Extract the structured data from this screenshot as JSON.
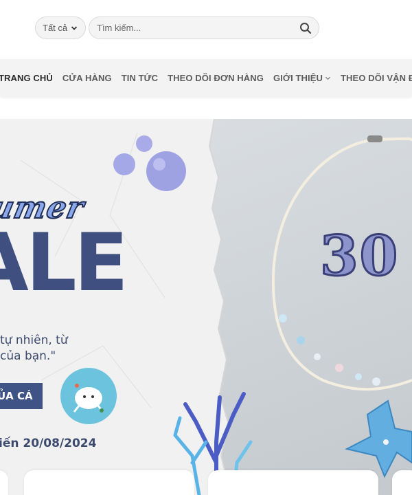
{
  "header": {
    "category_select": "Tất cả",
    "search_placeholder": "Tìm kiếm..."
  },
  "nav": {
    "items": [
      {
        "label": "TRANG CHỦ",
        "active": true
      },
      {
        "label": "CỬA HÀNG"
      },
      {
        "label": "TIN TỨC"
      },
      {
        "label": "THEO DÕI ĐƠN HÀNG"
      },
      {
        "label": "GIỚI THIỆU",
        "dropdown": true
      },
      {
        "label": "THEO DÕI VẬN ĐƠN"
      }
    ]
  },
  "hero": {
    "script_title": "umer",
    "headline": "ALE",
    "tagline_line1": "tự nhiên, từ",
    "tagline_line2": "của bạn.\"",
    "cta_label": "ỦA CÁ",
    "until_text": "iến 20/08/2024",
    "discount_text": "30",
    "accent_color": "#3e4f80",
    "badge_color": "#6cc3de"
  }
}
